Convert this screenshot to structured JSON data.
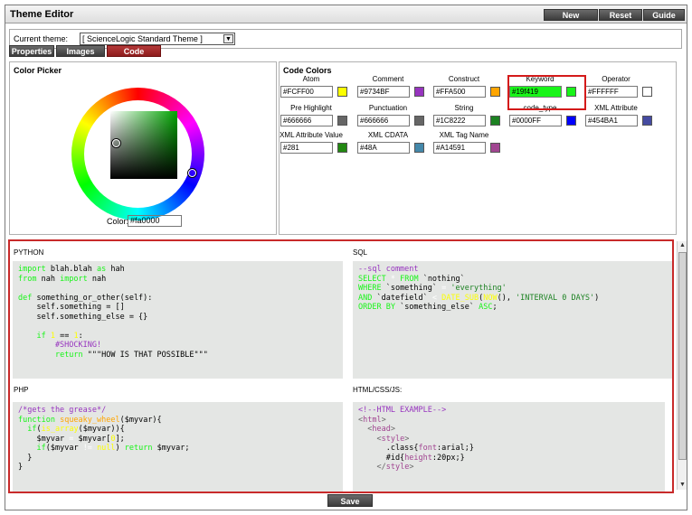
{
  "app": {
    "title": "Theme Editor"
  },
  "toolbar": {
    "new_label": "New",
    "reset_label": "Reset",
    "guide_label": "Guide"
  },
  "theme": {
    "label": "Current theme:",
    "selected": "[ ScienceLogic Standard Theme ]"
  },
  "tabs": [
    {
      "label": "Properties",
      "active": false
    },
    {
      "label": "Images",
      "active": false
    },
    {
      "label": "Code",
      "active": true
    }
  ],
  "color_picker": {
    "title": "Color Picker",
    "color_label": "Color:",
    "color_value": "#fa0000"
  },
  "code_colors": {
    "title": "Code Colors",
    "items": [
      {
        "label": "Atom",
        "value": "#FCFF00",
        "swatch": "#FCFF00"
      },
      {
        "label": "Comment",
        "value": "#9734BF",
        "swatch": "#9734BF"
      },
      {
        "label": "Construct",
        "value": "#FFA500",
        "swatch": "#FFA500"
      },
      {
        "label": "Keyword",
        "value": "#19f419",
        "swatch": "#19f419"
      },
      {
        "label": "Operator",
        "value": "#FFFFFF",
        "swatch": "#FFFFFF"
      },
      {
        "label": "Pre Highlight",
        "value": "#666666",
        "swatch": "#666666"
      },
      {
        "label": "Punctuation",
        "value": "#666666",
        "swatch": "#666666"
      },
      {
        "label": "String",
        "value": "#1C8222",
        "swatch": "#1C8222"
      },
      {
        "label": "code_type",
        "value": "#0000FF",
        "swatch": "#0000FF"
      },
      {
        "label": "XML Attribute",
        "value": "#454BA1",
        "swatch": "#454BA1"
      },
      {
        "label": "XML Attribute Value",
        "value": "#281",
        "swatch": "#228811"
      },
      {
        "label": "XML CDATA",
        "value": "#48A",
        "swatch": "#4488AA"
      },
      {
        "label": "XML Tag Name",
        "value": "#A14591",
        "swatch": "#A14591"
      }
    ]
  },
  "preview": {
    "python": {
      "label": "PYTHON",
      "lines": [
        [
          [
            "import",
            "#19f419"
          ],
          [
            " blah.blah ",
            "#000000"
          ],
          [
            "as",
            "#19f419"
          ],
          [
            " hah",
            "#000000"
          ]
        ],
        [
          [
            "from",
            "#19f419"
          ],
          [
            " nah ",
            "#000000"
          ],
          [
            "import",
            "#19f419"
          ],
          [
            " nah",
            "#000000"
          ]
        ],
        [],
        [
          [
            "def",
            "#19f419"
          ],
          [
            " something_or_other(self):",
            "#000000"
          ]
        ],
        [
          [
            "    self.something = []",
            "#000000"
          ]
        ],
        [
          [
            "    self.something_else = {}",
            "#000000"
          ]
        ],
        [],
        [
          [
            "    ",
            "#000000"
          ],
          [
            "if",
            "#19f419"
          ],
          [
            " ",
            "#000000"
          ],
          [
            "1",
            "#FCFF00"
          ],
          [
            " == ",
            "#000000"
          ],
          [
            "1",
            "#FCFF00"
          ],
          [
            ":",
            "#000000"
          ]
        ],
        [
          [
            "        #SHOCKING!",
            "#9734BF"
          ]
        ],
        [
          [
            "        ",
            "#000000"
          ],
          [
            "return",
            "#19f419"
          ],
          [
            " \"\"\"HOW IS THAT POSSIBLE\"\"\"",
            "#000000"
          ]
        ]
      ]
    },
    "sql": {
      "label": "SQL",
      "lines": [
        [
          [
            "--sql comment",
            "#9734BF"
          ]
        ],
        [
          [
            "SELECT",
            "#19f419"
          ],
          [
            " ",
            "#000000"
          ],
          [
            "*",
            "#FFFFFF"
          ],
          [
            " ",
            "#000000"
          ],
          [
            "FROM",
            "#19f419"
          ],
          [
            " `nothing`",
            "#000000"
          ]
        ],
        [
          [
            "WHERE",
            "#19f419"
          ],
          [
            " `something` ",
            "#000000"
          ],
          [
            "=",
            "#FFFFFF"
          ],
          [
            " 'everything'",
            "#1C8222"
          ]
        ],
        [
          [
            "AND",
            "#19f419"
          ],
          [
            " `datefield` ",
            "#000000"
          ],
          [
            "<",
            "#FFFFFF"
          ],
          [
            " ",
            "#000000"
          ],
          [
            "DATE_SUB",
            "#FCFF00"
          ],
          [
            "(",
            "#000000"
          ],
          [
            "NOW",
            "#FCFF00"
          ],
          [
            "(), ",
            "#000000"
          ],
          [
            "'INTERVAL 0 DAYS'",
            "#1C8222"
          ],
          [
            ")",
            "#000000"
          ]
        ],
        [
          [
            "ORDER BY",
            "#19f419"
          ],
          [
            " `something_else` ",
            "#000000"
          ],
          [
            "ASC",
            "#19f419"
          ],
          [
            ";",
            "#000000"
          ]
        ]
      ]
    },
    "php": {
      "label": "PHP",
      "lines": [
        [
          [
            "/*gets the grease*/",
            "#9734BF"
          ]
        ],
        [
          [
            "function",
            "#19f419"
          ],
          [
            " ",
            "#000000"
          ],
          [
            "squeaky_wheel",
            "#FFA500"
          ],
          [
            "($myvar){",
            "#000000"
          ]
        ],
        [
          [
            "  ",
            "#000000"
          ],
          [
            "if",
            "#19f419"
          ],
          [
            "(",
            "#000000"
          ],
          [
            "is_array",
            "#FCFF00"
          ],
          [
            "($myvar)){",
            "#000000"
          ]
        ],
        [
          [
            "    $myvar ",
            "#000000"
          ],
          [
            "=",
            "#FFFFFF"
          ],
          [
            " $myvar[",
            "#000000"
          ],
          [
            "0",
            "#FCFF00"
          ],
          [
            "];",
            "#000000"
          ]
        ],
        [
          [
            "    ",
            "#000000"
          ],
          [
            "if",
            "#19f419"
          ],
          [
            "($myvar ",
            "#000000"
          ],
          [
            "!=",
            "#FFFFFF"
          ],
          [
            " ",
            "#000000"
          ],
          [
            "null",
            "#FCFF00"
          ],
          [
            ") ",
            "#000000"
          ],
          [
            "return",
            "#19f419"
          ],
          [
            " $myvar;",
            "#000000"
          ]
        ],
        [
          [
            "  }",
            "#000000"
          ]
        ],
        [
          [
            "}",
            "#000000"
          ]
        ]
      ]
    },
    "html": {
      "label": "HTML/CSS/JS:",
      "lines": [
        [
          [
            "<!--HTML EXAMPLE-->",
            "#9734BF"
          ]
        ],
        [
          [
            "<",
            "#666666"
          ],
          [
            "html",
            "#A14591"
          ],
          [
            ">",
            "#666666"
          ]
        ],
        [
          [
            "  <",
            "#666666"
          ],
          [
            "head",
            "#A14591"
          ],
          [
            ">",
            "#666666"
          ]
        ],
        [
          [
            "    <",
            "#666666"
          ],
          [
            "style",
            "#A14591"
          ],
          [
            ">",
            "#666666"
          ]
        ],
        [
          [
            "      .class{",
            "#000000"
          ],
          [
            "font",
            "#A14591"
          ],
          [
            ":arial;}",
            "#000000"
          ]
        ],
        [
          [
            "      #id{",
            "#000000"
          ],
          [
            "height",
            "#A14591"
          ],
          [
            ":20px;}",
            "#000000"
          ]
        ],
        [
          [
            "    </",
            "#666666"
          ],
          [
            "style",
            "#A14591"
          ],
          [
            ">",
            "#666666"
          ]
        ]
      ]
    }
  },
  "save": {
    "label": "Save"
  }
}
